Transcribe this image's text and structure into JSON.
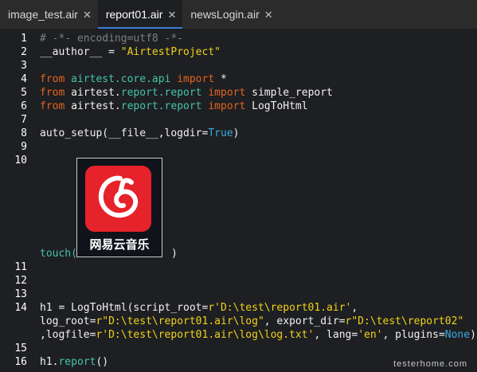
{
  "tabs": [
    {
      "label": "image_test.air",
      "close": "✕",
      "active": false
    },
    {
      "label": "report01.air",
      "close": "✕",
      "active": true
    },
    {
      "label": "newsLogin.air",
      "close": "✕",
      "active": false
    }
  ],
  "line_numbers": [
    "1",
    "2",
    "3",
    "4",
    "5",
    "6",
    "7",
    "8",
    "9",
    "10",
    "11",
    "12",
    "13",
    "14",
    "15",
    "16"
  ],
  "code": {
    "l1": {
      "comment": "# -*- encoding=utf8 -*-"
    },
    "l2": {
      "a": "__author__ = ",
      "b": "\"AirtestProject\""
    },
    "l4": {
      "kw1": "from",
      "mod": "airtest.core.api",
      "kw2": "import",
      "rest": " *"
    },
    "l5": {
      "kw1": "from",
      "mod_a": "airtest.",
      "mod_b": "report.report",
      "kw2": "import",
      "rest": " simple_report"
    },
    "l6": {
      "kw1": "from",
      "mod_a": "airtest.",
      "mod_b": "report.report",
      "kw2": "import",
      "rest": " LogToHtml"
    },
    "l8": {
      "a": "auto_setup(__file__,logdir=",
      "b": "True",
      "c": ")"
    },
    "l10": {
      "a": "touch(",
      "b": ")"
    },
    "l14a": {
      "a": "h1 = LogToHtml(script_root=",
      "b": "r'D:\\test\\report01.air'",
      "c": ","
    },
    "l14b": {
      "a": "log_root=",
      "b": "r\"D:\\test\\report01.air\\log\"",
      "c": ", export_dir=",
      "d": "r\"D:\\test\\report02\""
    },
    "l14c": {
      "a": ",logfile=",
      "b": "r'D:\\test\\report01.air\\log\\log.txt'",
      "c": ", lang=",
      "d": "'en'",
      "e": ", plugins=",
      "f": "None",
      "g": ")"
    },
    "l16": {
      "a": "h1.",
      "b": "report",
      "c": "()"
    }
  },
  "thumbnail": {
    "caption": "网易云音乐"
  },
  "watermark": "testerhome.com",
  "colors": {
    "keyword": "#e0651f",
    "string": "#f0d21b",
    "module": "#44c4aa",
    "constant": "#39a9e0",
    "comment": "#7b8087",
    "tab_accent": "#3b7bd8",
    "app_icon": "#e6222a"
  }
}
